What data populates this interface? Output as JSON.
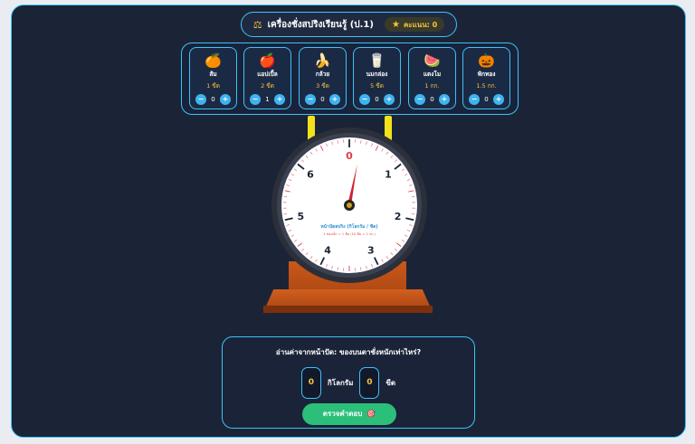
{
  "header": {
    "title": "เครื่องชั่งสปริงเรียนรู้ (ป.1)",
    "scale_icon": "scale-icon",
    "score_label": "คะแนน: 0",
    "star_icon": "star-icon"
  },
  "items": [
    {
      "emoji": "🍊",
      "name": "ส้ม",
      "weight": "1 ขีด",
      "count": "0"
    },
    {
      "emoji": "🍎",
      "name": "แอปเปิ้ล",
      "weight": "2 ขีด",
      "count": "1"
    },
    {
      "emoji": "🍌",
      "name": "กล้วย",
      "weight": "3 ขีด",
      "count": "0"
    },
    {
      "emoji": "🥛",
      "name": "นมกล่อง",
      "weight": "5 ขีด",
      "count": "0"
    },
    {
      "emoji": "🍉",
      "name": "แตงโม",
      "weight": "1 กก.",
      "count": "0"
    },
    {
      "emoji": "🎃",
      "name": "ฟักทอง",
      "weight": "1.5 กก.",
      "count": "0"
    }
  ],
  "stepper": {
    "minus": "−",
    "plus": "+"
  },
  "dial": {
    "numbers": [
      "0",
      "1",
      "2",
      "3",
      "4",
      "5",
      "6"
    ],
    "caption": "หน้าปัดสปริง (กิโลกรัม / ขีด)",
    "sub_caption": "1 ช่องเล็ก = 1 ขีด (10 ขีด = 1 กก.)",
    "needle_kg": 0.2
  },
  "question": {
    "prompt": "อ่านค่าจากหน้าปัด: ของบนตาชั่งหนักเท่าไหร่?",
    "kg_value": "0",
    "kg_unit": "กิโลกรัม",
    "hg_value": "0",
    "hg_unit": "ขีด",
    "check_label": "ตรวจคำตอบ",
    "target_icon": "🎯"
  },
  "colors": {
    "accent": "#3ec3f5",
    "gold": "#f5c542",
    "needle": "#d0212f",
    "button_green": "#2bbf7a",
    "base_orange": "#c9571a"
  }
}
